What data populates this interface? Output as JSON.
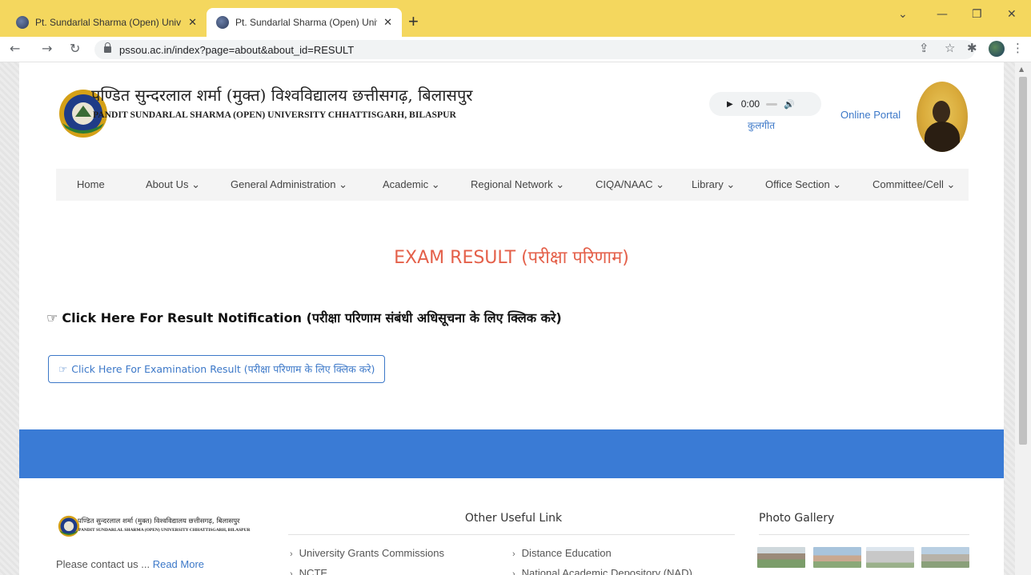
{
  "browser": {
    "tabs": [
      {
        "title": "Pt. Sundarlal Sharma (Open) Univ",
        "active": false
      },
      {
        "title": "Pt. Sundarlal Sharma (Open) Univ",
        "active": true
      }
    ],
    "url": "pssou.ac.in/index?page=about&about_id=RESULT"
  },
  "header": {
    "title_hindi": "पण्डित सुन्दरलाल शर्मा (मुक्त) विश्वविद्यालय छत्तीसगढ़, बिलासपुर",
    "title_english": "PANDIT SUNDARLAL SHARMA (OPEN) UNIVERSITY CHHATTISGARH, BILASPUR",
    "audio_time": "0:00",
    "kulgeet_label": "कुलगीत",
    "online_portal_label": "Online Portal"
  },
  "nav": {
    "items": [
      {
        "label": "Home"
      },
      {
        "label": "About Us ⌄"
      },
      {
        "label": "General Administration ⌄"
      },
      {
        "label": "Academic ⌄"
      },
      {
        "label": "Regional Network ⌄"
      },
      {
        "label": "CIQA/NAAC ⌄"
      },
      {
        "label": "Library ⌄"
      },
      {
        "label": "Office Section ⌄"
      },
      {
        "label": "Committee/Cell ⌄"
      }
    ]
  },
  "content": {
    "heading": "EXAM RESULT (परीक्षा परिणाम)",
    "notification_label": "Click Here For Result Notification (परीक्षा परिणाम संबंधी अधिसूचना के लिए क्लिक करे)",
    "exam_result_button": "Click Here For Examination Result (परीक्षा परिणाम के लिए क्लिक करे)"
  },
  "footer": {
    "title_hindi": "पण्डित सुन्दरलाल शर्मा (मुक्त) विश्वविद्यालय छत्तीसगढ़, बिलासपुर",
    "title_english": "PANDIT SUNDARLAL SHARMA (OPEN) UNIVERSITY CHHATTISGARH, BILASPUR",
    "contact_text": "Please contact us ...",
    "read_more": "Read More",
    "useful_links_heading": "Other Useful Link",
    "useful_links": [
      "University Grants Commissions",
      "Distance Education",
      "NCTE",
      "National Academic Depository (NAD)"
    ],
    "gallery_heading": "Photo Gallery"
  },
  "colors": {
    "tab_strip": "#f4d75e",
    "accent_blue": "#3a7bd5",
    "heading_red": "#e4604a",
    "link_blue": "#3c78c8"
  }
}
